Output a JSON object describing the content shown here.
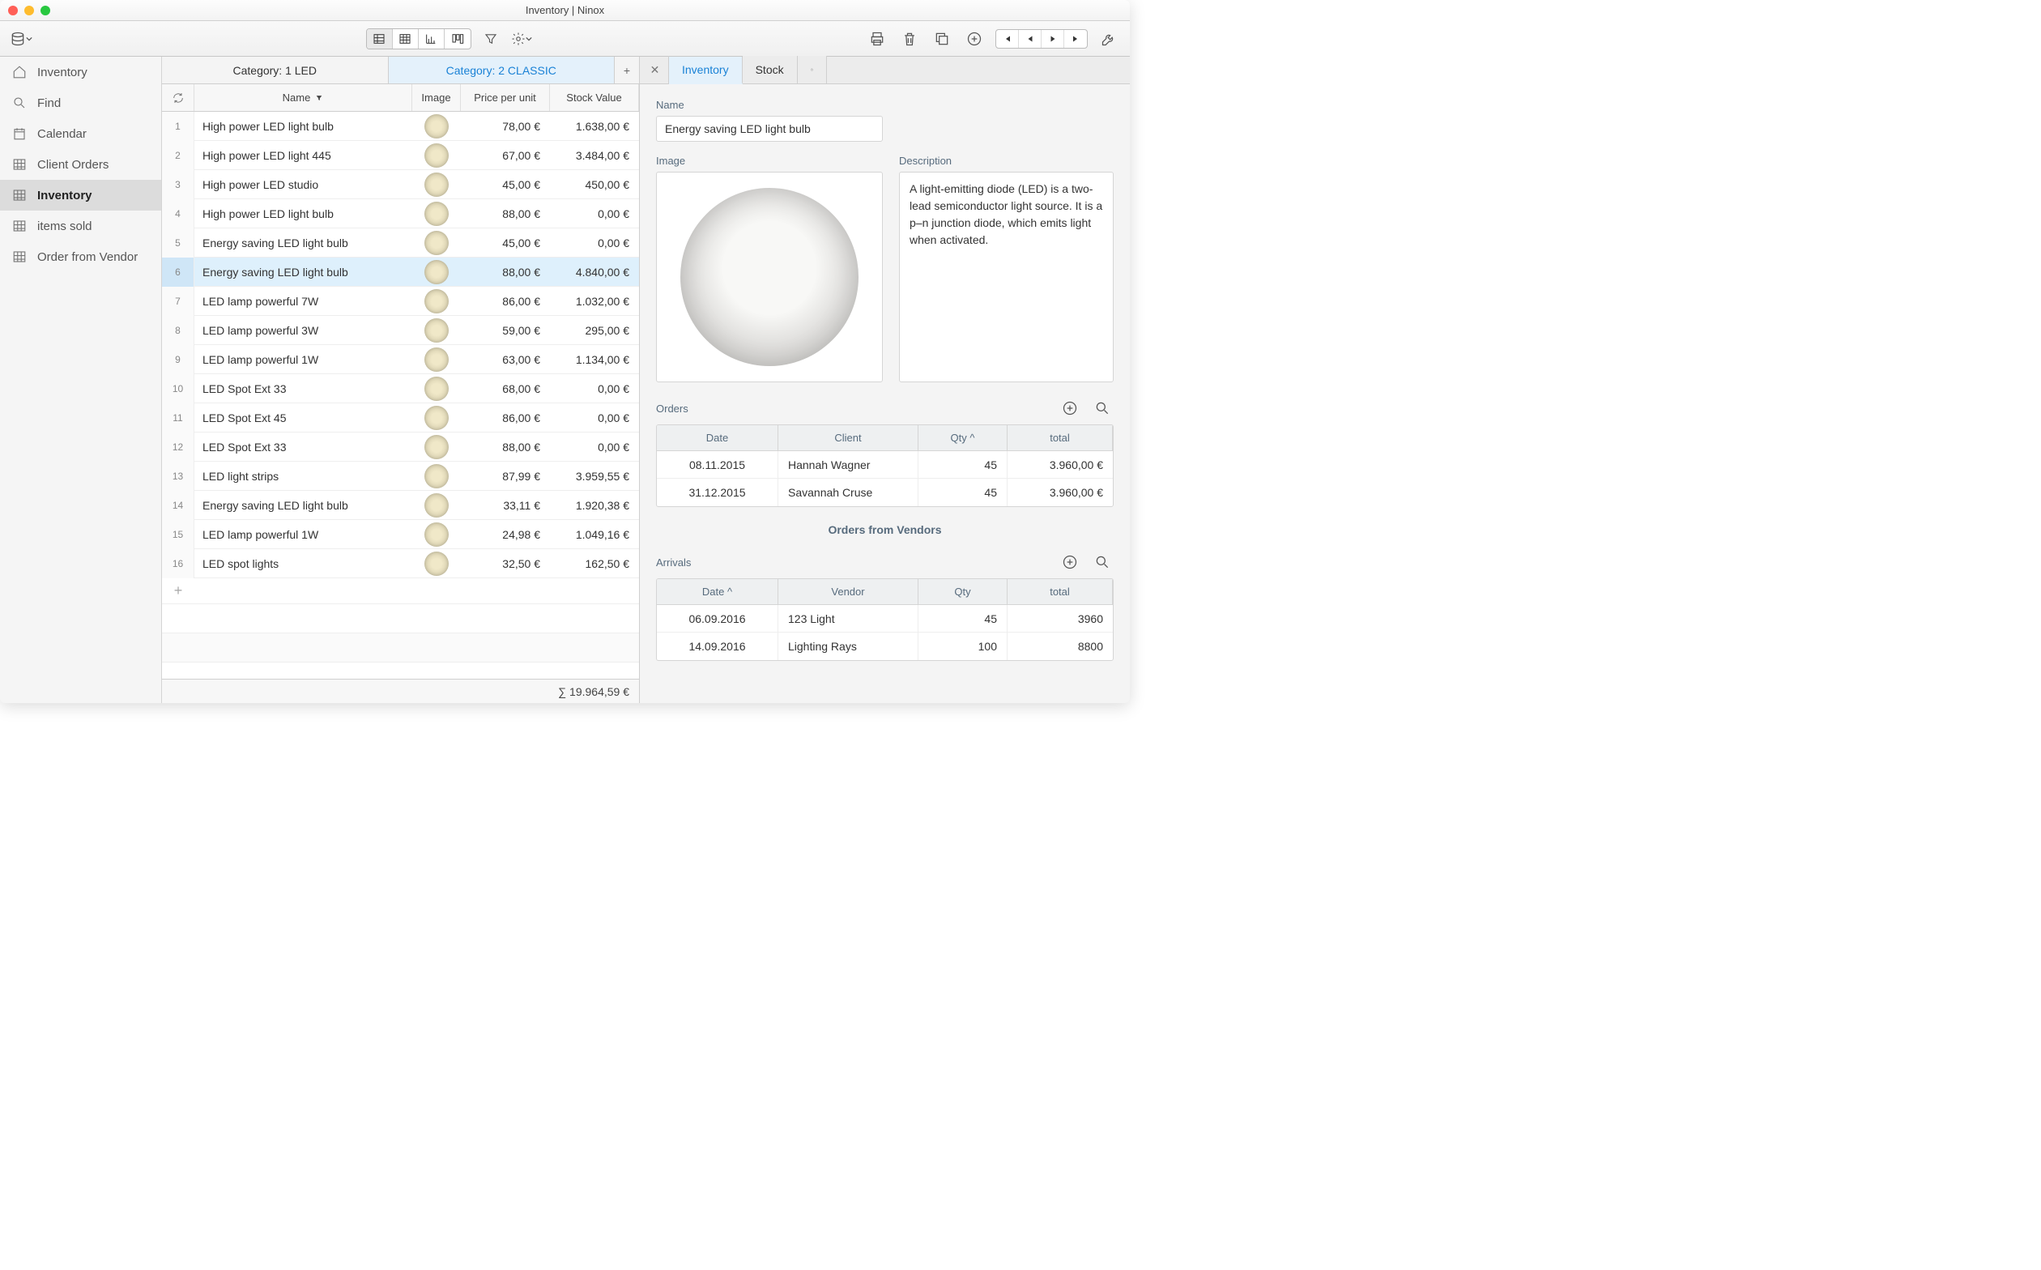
{
  "window": {
    "title": "Inventory | Ninox"
  },
  "sidebar": {
    "items": [
      {
        "icon": "home",
        "label": "Inventory"
      },
      {
        "icon": "search",
        "label": "Find"
      },
      {
        "icon": "calendar",
        "label": "Calendar"
      },
      {
        "icon": "grid",
        "label": "Client Orders"
      },
      {
        "icon": "grid",
        "label": "Inventory",
        "active": true
      },
      {
        "icon": "grid",
        "label": "items sold"
      },
      {
        "icon": "grid",
        "label": "Order from Vendor"
      }
    ]
  },
  "categories": {
    "tabs": [
      {
        "label": "Category: 1 LED"
      },
      {
        "label": "Category: 2 CLASSIC",
        "active": true
      }
    ],
    "add": "+"
  },
  "grid": {
    "headers": {
      "name": "Name",
      "image": "Image",
      "price": "Price per unit",
      "stock": "Stock Value"
    },
    "rows": [
      {
        "n": "1",
        "name": "High power LED light bulb",
        "price": "78,00 €",
        "stock": "1.638,00 €"
      },
      {
        "n": "2",
        "name": "High power LED light 445",
        "price": "67,00 €",
        "stock": "3.484,00 €"
      },
      {
        "n": "3",
        "name": "High power LED studio",
        "price": "45,00 €",
        "stock": "450,00 €"
      },
      {
        "n": "4",
        "name": "High power LED light bulb",
        "price": "88,00 €",
        "stock": "0,00 €"
      },
      {
        "n": "5",
        "name": "Energy saving LED light bulb",
        "price": "45,00 €",
        "stock": "0,00 €"
      },
      {
        "n": "6",
        "name": "Energy saving LED light bulb",
        "price": "88,00 €",
        "stock": "4.840,00 €",
        "selected": true
      },
      {
        "n": "7",
        "name": "LED lamp powerful 7W",
        "price": "86,00 €",
        "stock": "1.032,00 €"
      },
      {
        "n": "8",
        "name": "LED lamp powerful 3W",
        "price": "59,00 €",
        "stock": "295,00 €"
      },
      {
        "n": "9",
        "name": "LED lamp powerful 1W",
        "price": "63,00 €",
        "stock": "1.134,00 €"
      },
      {
        "n": "10",
        "name": "LED Spot Ext 33",
        "price": "68,00 €",
        "stock": "0,00 €"
      },
      {
        "n": "11",
        "name": "LED Spot Ext 45",
        "price": "86,00 €",
        "stock": "0,00 €"
      },
      {
        "n": "12",
        "name": "LED Spot Ext 33",
        "price": "88,00 €",
        "stock": "0,00 €"
      },
      {
        "n": "13",
        "name": "LED light strips",
        "price": "87,99 €",
        "stock": "3.959,55 €"
      },
      {
        "n": "14",
        "name": "Energy saving LED light bulb",
        "price": "33,11 €",
        "stock": "1.920,38 €"
      },
      {
        "n": "15",
        "name": "LED lamp powerful 1W",
        "price": "24,98 €",
        "stock": "1.049,16 €"
      },
      {
        "n": "16",
        "name": "LED spot lights",
        "price": "32,50 €",
        "stock": "162,50 €"
      }
    ],
    "footer_sum": "∑ 19.964,59 €"
  },
  "detail": {
    "tabs": [
      {
        "label": "Inventory",
        "active": true
      },
      {
        "label": "Stock"
      }
    ],
    "name_label": "Name",
    "name_value": "Energy saving LED light bulb",
    "image_label": "Image",
    "desc_label": "Description",
    "desc_value": "A light-emitting diode (LED) is a two-lead semiconductor light source. It is a p–n junction diode, which emits light when activated.",
    "orders": {
      "title": "Orders",
      "headers": {
        "date": "Date",
        "client": "Client",
        "qty": "Qty ^",
        "total": "total"
      },
      "rows": [
        {
          "date": "08.11.2015",
          "client": "Hannah Wagner",
          "qty": "45",
          "total": "3.960,00 €"
        },
        {
          "date": "31.12.2015",
          "client": "Savannah Cruse",
          "qty": "45",
          "total": "3.960,00 €"
        }
      ]
    },
    "vendors_title": "Orders from Vendors",
    "arrivals": {
      "title": "Arrivals",
      "headers": {
        "date": "Date ^",
        "vendor": "Vendor",
        "qty": "Qty",
        "total": "total"
      },
      "rows": [
        {
          "date": "06.09.2016",
          "vendor": "123 Light",
          "qty": "45",
          "total": "3960"
        },
        {
          "date": "14.09.2016",
          "vendor": "Lighting Rays",
          "qty": "100",
          "total": "8800"
        }
      ]
    }
  }
}
